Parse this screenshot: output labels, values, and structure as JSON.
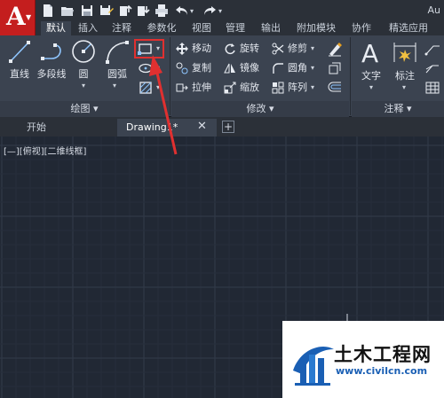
{
  "app": {
    "title": "Au",
    "menu_button_letter": "A"
  },
  "quick_access": [
    "new-icon",
    "open-icon",
    "save-icon",
    "save-as-icon",
    "upload-icon",
    "download-icon",
    "print-icon",
    "undo-icon",
    "redo-icon"
  ],
  "ribbon_tabs": [
    "默认",
    "插入",
    "注释",
    "参数化",
    "视图",
    "管理",
    "输出",
    "附加模块",
    "协作",
    "精选应用"
  ],
  "draw_panel": {
    "footer": "绘图 ▾",
    "line": "直线",
    "polyline": "多段线",
    "circle": "圆",
    "arc": "圆弧"
  },
  "modify_panel": {
    "footer": "修改 ▾",
    "move": "移动",
    "rotate": "旋转",
    "trim": "修剪",
    "copy": "复制",
    "mirror": "镜像",
    "fillet": "圆角",
    "stretch": "拉伸",
    "scale": "缩放",
    "array": "阵列"
  },
  "annotation_panel": {
    "footer": "注释",
    "text": "文字",
    "dimension": "标注"
  },
  "file_tabs": {
    "start": "开始",
    "drawing": "Drawing1*",
    "close": "✕",
    "add": "+"
  },
  "viewport_label": "[—][俯视][二维线框]",
  "watermark": {
    "name": "土木工程网",
    "url": "www.civilcn.com"
  },
  "colors": {
    "accent": "#c41e1e",
    "highlight_box": "#e03030",
    "ribbon_bg": "#3b4350",
    "canvas_bg": "#212834"
  }
}
